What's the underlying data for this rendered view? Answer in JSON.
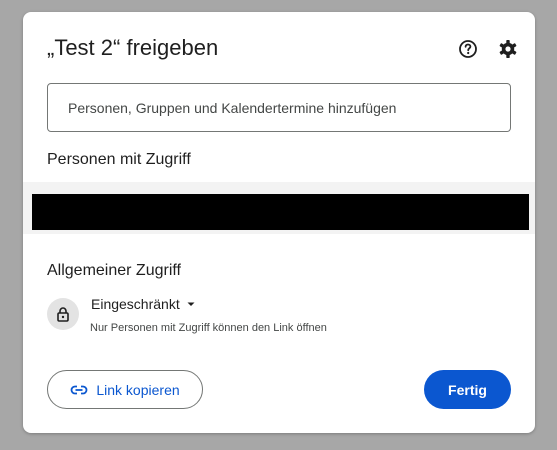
{
  "dialog": {
    "title": "„Test 2“ freigeben",
    "help_icon": "help-circle-icon",
    "settings_icon": "gear-icon"
  },
  "add_people": {
    "placeholder": "Personen, Gruppen und Kalendertermine hinzufügen",
    "value": ""
  },
  "people_with_access": {
    "label": "Personen mit Zugriff"
  },
  "general_access": {
    "label": "Allgemeiner Zugriff",
    "icon": "lock-icon",
    "selected": "Eingeschränkt",
    "description": "Nur Personen mit Zugriff können den Link öffnen"
  },
  "actions": {
    "copy_link_label": "Link kopieren",
    "copy_link_icon": "link-icon",
    "done_label": "Fertig"
  },
  "colors": {
    "accent": "#0b57d0",
    "backdrop": "#a7a7a7",
    "surface": "#ffffff"
  }
}
